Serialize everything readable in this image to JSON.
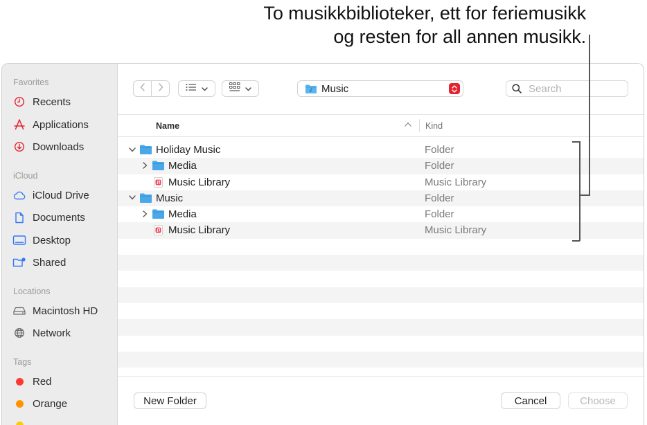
{
  "callout": {
    "line1": "To musikkbiblioteker, ett for feriemusikk",
    "line2": "og resten for all annen musikk."
  },
  "sidebar": {
    "favorites_label": "Favorites",
    "favorites": [
      {
        "label": "Recents",
        "icon": "clock-icon"
      },
      {
        "label": "Applications",
        "icon": "applications-icon"
      },
      {
        "label": "Downloads",
        "icon": "download-icon"
      }
    ],
    "icloud_label": "iCloud",
    "icloud": [
      {
        "label": "iCloud Drive",
        "icon": "cloud-icon"
      },
      {
        "label": "Documents",
        "icon": "document-icon"
      },
      {
        "label": "Desktop",
        "icon": "desktop-icon"
      },
      {
        "label": "Shared",
        "icon": "shared-folder-icon"
      }
    ],
    "locations_label": "Locations",
    "locations": [
      {
        "label": "Macintosh HD",
        "icon": "disk-icon"
      },
      {
        "label": "Network",
        "icon": "globe-icon"
      }
    ],
    "tags_label": "Tags",
    "tags": [
      {
        "label": "Red",
        "color": "#ff3b30"
      },
      {
        "label": "Orange",
        "color": "#ff9500"
      }
    ]
  },
  "toolbar": {
    "location": "Music",
    "search_placeholder": "Search"
  },
  "columns": {
    "name": "Name",
    "kind": "Kind"
  },
  "rows": [
    {
      "name": "Holiday Music",
      "kind": "Folder",
      "expanded": true
    },
    {
      "name": "Media",
      "kind": "Folder",
      "expanded": false
    },
    {
      "name": "Music Library",
      "kind": "Music Library"
    },
    {
      "name": "Music",
      "kind": "Folder",
      "expanded": true
    },
    {
      "name": "Media",
      "kind": "Folder",
      "expanded": false
    },
    {
      "name": "Music Library",
      "kind": "Music Library"
    }
  ],
  "footer": {
    "new_folder": "New Folder",
    "cancel": "Cancel",
    "choose": "Choose"
  },
  "colors": {
    "folder": "#4aa8e8",
    "accent_red": "#e5232f"
  }
}
